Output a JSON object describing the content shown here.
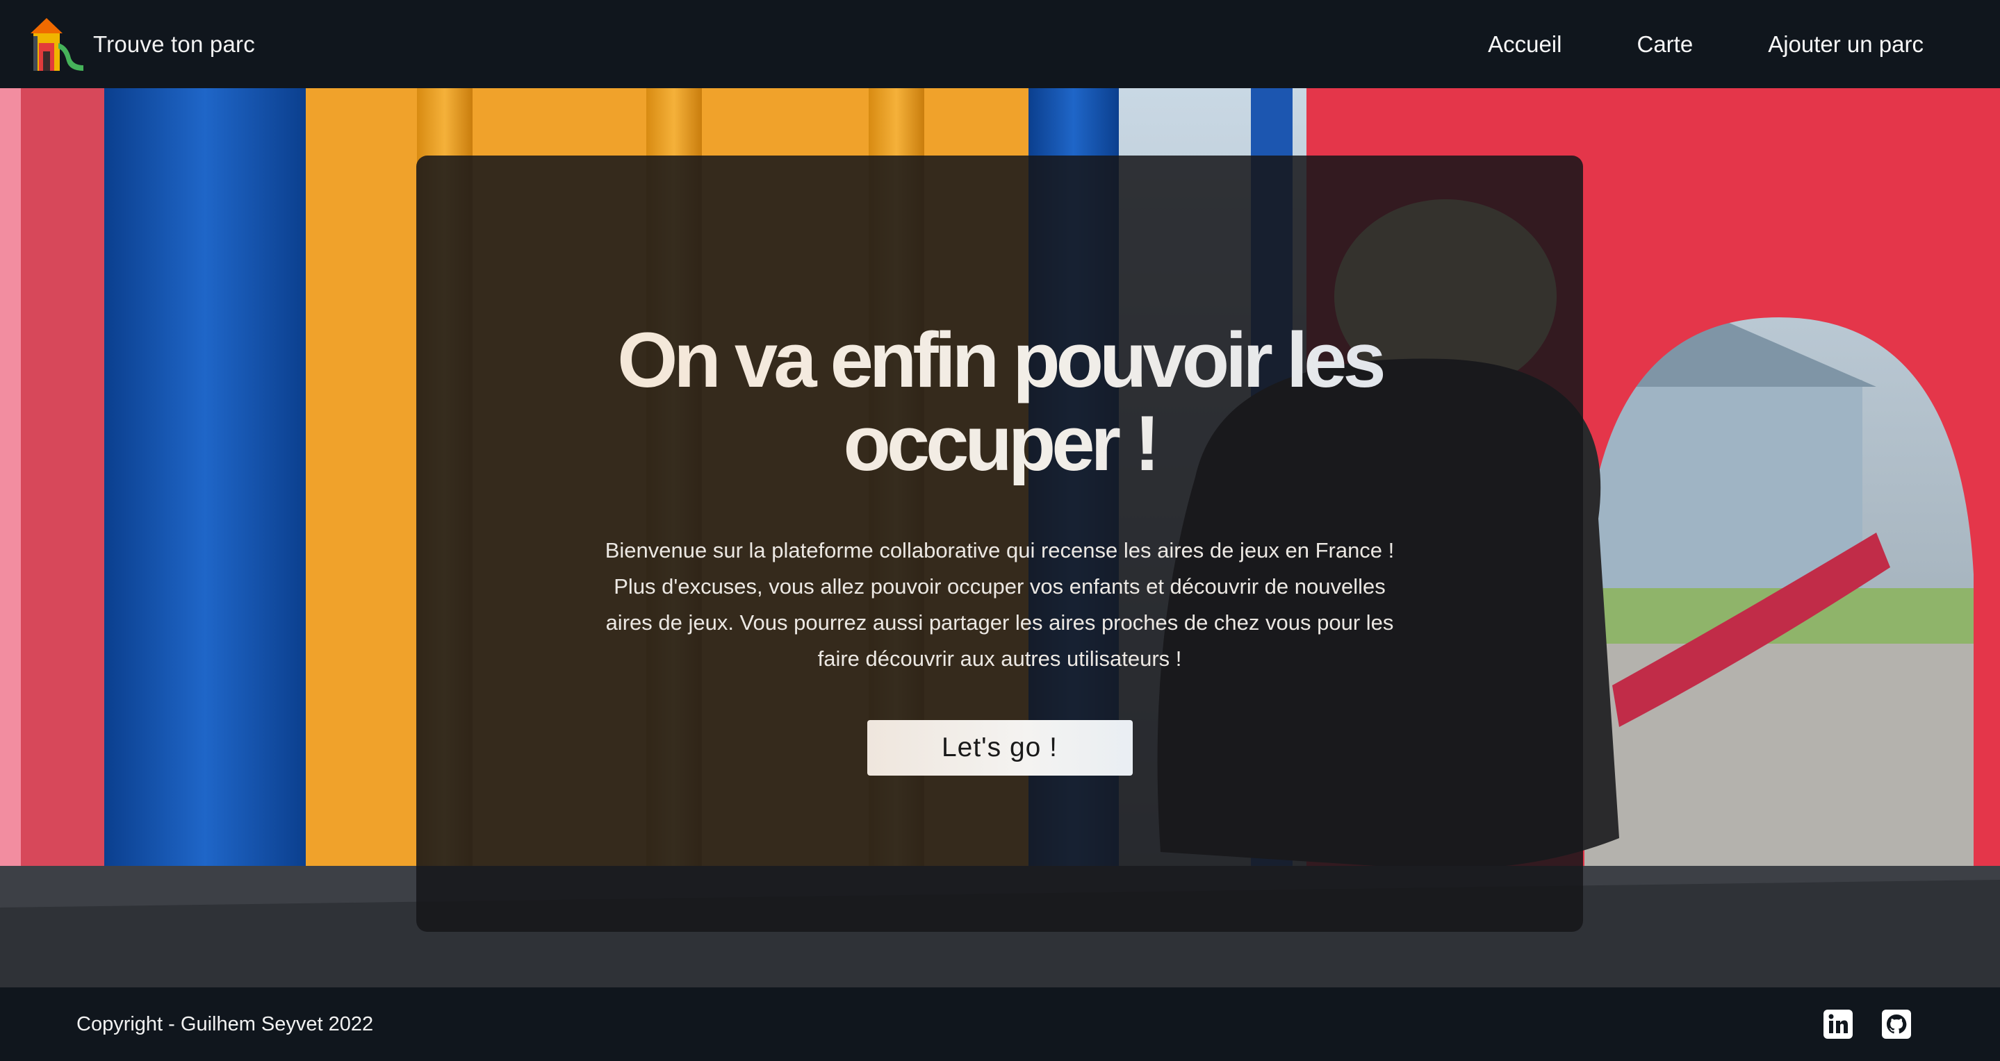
{
  "navbar": {
    "brand": "Trouve ton parc",
    "links": [
      {
        "label": "Accueil"
      },
      {
        "label": "Carte"
      },
      {
        "label": "Ajouter un parc"
      }
    ]
  },
  "hero": {
    "headline": "On va enfin pouvoir les occuper !",
    "intro": "Bienvenue sur la plateforme collaborative qui recense les aires de jeux en France ! Plus d'excuses, vous allez pouvoir occuper vos enfants et découvrir de nouvelles aires de jeux. Vous pourrez aussi partager les aires proches de chez vous pour les faire découvrir aux autres utilisateurs !",
    "cta": "Let's go !"
  },
  "footer": {
    "copyright": "Copyright - Guilhem Seyvet 2022",
    "socials": [
      {
        "icon": "linkedin-icon"
      },
      {
        "icon": "github-icon"
      }
    ]
  },
  "colors": {
    "nav_bg": "#10161d",
    "card_bg": "rgba(22,22,26,0.86)",
    "text": "#f2f2f2",
    "cta_bg": "#f4f3f1"
  }
}
